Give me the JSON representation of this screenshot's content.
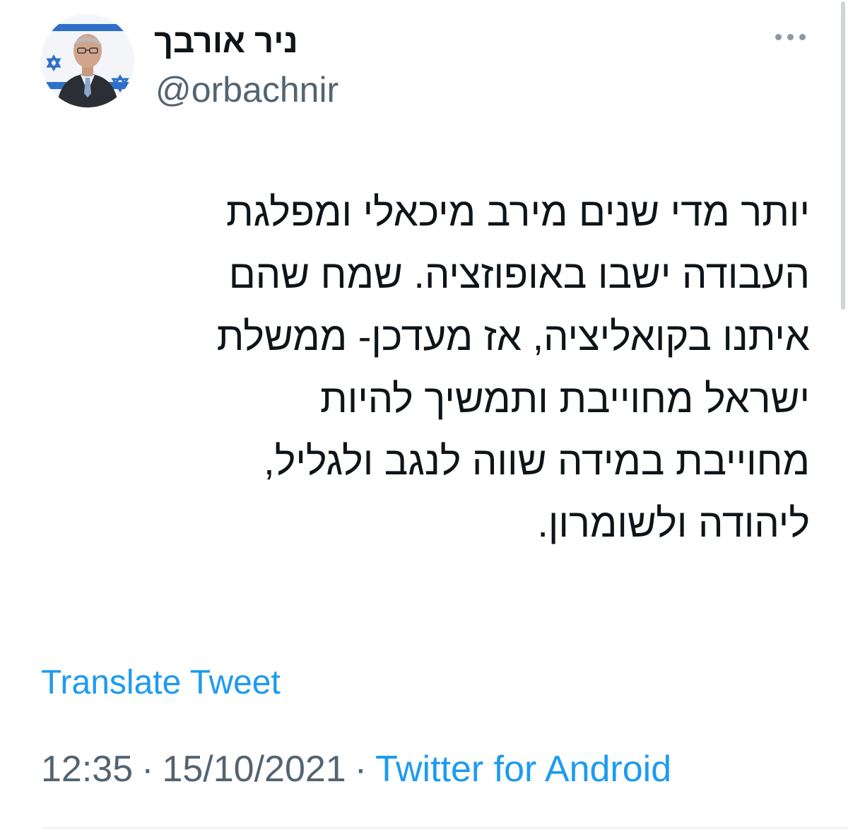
{
  "author": {
    "display_name": "ניר אורבך",
    "handle": "@orbachnir",
    "avatar_icon": "profile-photo"
  },
  "tweet": {
    "lines": [
      "יותר מדי שנים מירב מיכאלי ומפלגת",
      "העבודה ישבו באופוזציה. שמח שהם",
      "איתנו בקואליציה, אז מעדכן- ממשלת",
      "ישראל מחוייבת ותמשיך להיות",
      "מחוייבת במידה שווה לנגב ולגליל,",
      "ליהודה ולשומרון."
    ],
    "translate_label": "Translate Tweet"
  },
  "meta": {
    "time": "12:35",
    "separator": "·",
    "date": "15/10/2021",
    "source": "Twitter for Android"
  },
  "colors": {
    "text": "#0f1419",
    "secondary": "#536471",
    "link": "#1d9bf0",
    "background": "#ffffff"
  },
  "icons": {
    "more_menu": "more-horizontal-icon"
  }
}
